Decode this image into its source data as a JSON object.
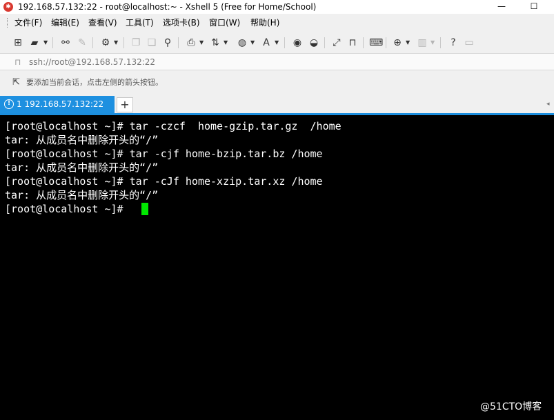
{
  "window": {
    "title": "192.168.57.132:22 - root@localhost:~ - Xshell 5 (Free for Home/School)",
    "minimize_glyph": "—",
    "maximize_glyph": "☐"
  },
  "menu": {
    "items": [
      {
        "label": "文件(F)"
      },
      {
        "label": "编辑(E)"
      },
      {
        "label": "查看(V)"
      },
      {
        "label": "工具(T)"
      },
      {
        "label": "选项卡(B)"
      },
      {
        "label": "窗口(W)"
      },
      {
        "label": "帮助(H)"
      }
    ]
  },
  "toolbar": {
    "icons": [
      "new-session-icon",
      "open-folder-icon",
      "reconnect-icon",
      "disconnect-icon",
      "properties-icon",
      "copy-icon",
      "paste-icon",
      "find-icon",
      "print-icon",
      "transfer-icon",
      "globe-icon",
      "font-icon",
      "xftp-icon",
      "xmanager-icon",
      "fullscreen-icon",
      "lock-icon",
      "keyboard-icon",
      "new-tab-icon",
      "layout-icon",
      "help-icon",
      "chat-icon"
    ]
  },
  "address": {
    "value": "ssh://root@192.168.57.132:22"
  },
  "hint": {
    "text": "要添加当前会话，点击左侧的箭头按钮。"
  },
  "tabs": [
    {
      "label": "1 192.168.57.132:22",
      "active": true,
      "alert": "!"
    }
  ],
  "new_tab_glyph": "+",
  "terminal": {
    "lines": [
      "[root@localhost ~]# tar -czcf  home-gzip.tar.gz  /home",
      "tar: 从成员名中删除开头的“/”",
      "[root@localhost ~]# tar -cjf home-bzip.tar.bz /home",
      "tar: 从成员名中删除开头的“/”",
      "[root@localhost ~]# tar -cJf home-xzip.tar.xz /home",
      "tar: 从成员名中删除开头的“/”",
      "[root@localhost ~]# "
    ]
  },
  "watermark": "@51CTO博客",
  "colors": {
    "tab_active": "#1e90e0",
    "cursor": "#00e800",
    "terminal_bg": "#000000",
    "terminal_fg": "#ffffff"
  }
}
